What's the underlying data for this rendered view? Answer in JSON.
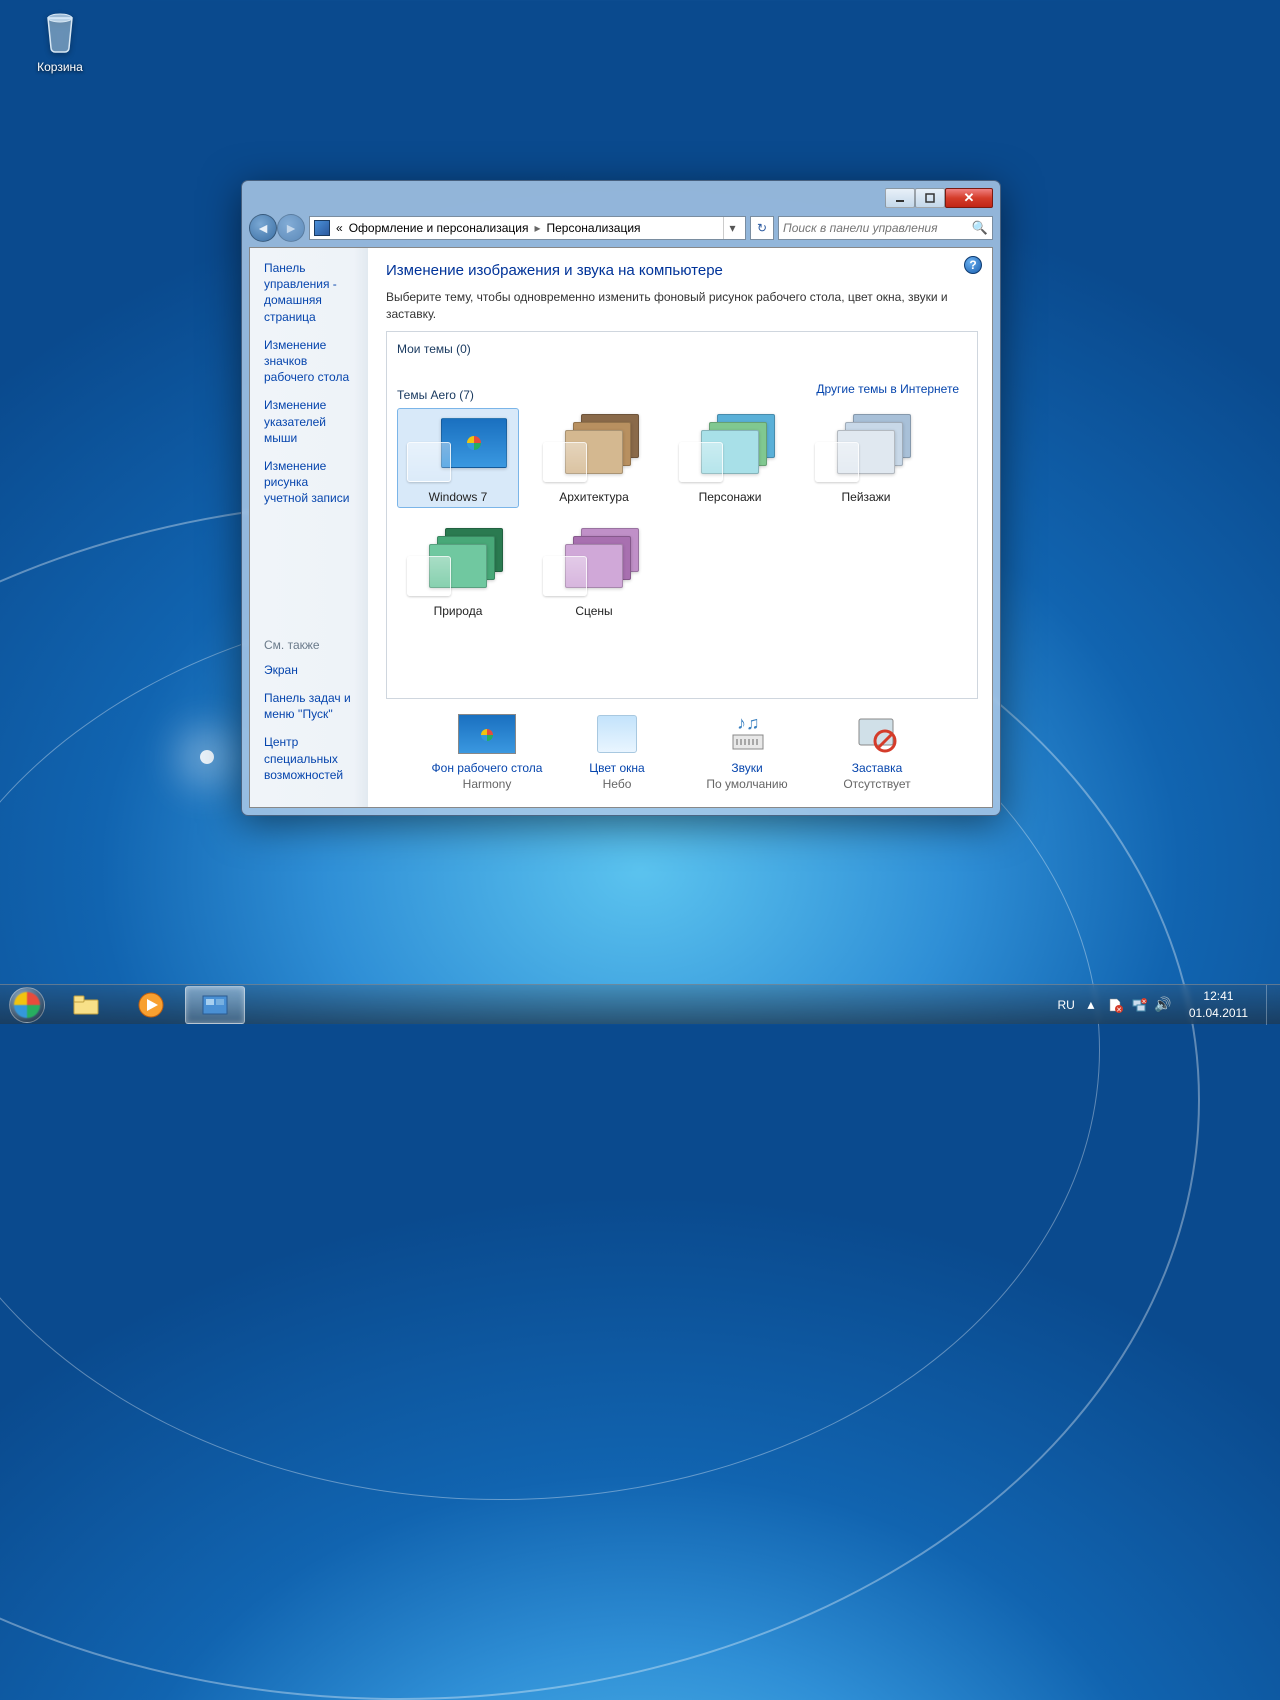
{
  "desktop": {
    "recycle_bin": "Корзина"
  },
  "window": {
    "breadcrumb": {
      "prefix": "«",
      "parent": "Оформление и персонализация",
      "current": "Персонализация"
    },
    "search_placeholder": "Поиск в панели управления",
    "sidebar": {
      "home": "Панель управления - домашняя страница",
      "links": [
        "Изменение значков рабочего стола",
        "Изменение указателей мыши",
        "Изменение рисунка учетной записи"
      ],
      "see_also_label": "См. также",
      "see_also": [
        "Экран",
        "Панель задач и меню ''Пуск''",
        "Центр специальных возможностей"
      ]
    },
    "main": {
      "title": "Изменение изображения и звука на компьютере",
      "description": "Выберите тему, чтобы одновременно изменить фоновый рисунок рабочего стола, цвет окна, звуки и заставку.",
      "my_themes": "Мои темы (0)",
      "aero_themes": "Темы Aero (7)",
      "more_online": "Другие темы в Интернете",
      "themes": [
        "Windows 7",
        "Архитектура",
        "Персонажи",
        "Пейзажи",
        "Природа",
        "Сцены"
      ],
      "settings": [
        {
          "title": "Фон рабочего стола",
          "sub": "Harmony"
        },
        {
          "title": "Цвет окна",
          "sub": "Небо"
        },
        {
          "title": "Звуки",
          "sub": "По умолчанию"
        },
        {
          "title": "Заставка",
          "sub": "Отсутствует"
        }
      ]
    }
  },
  "taskbar": {
    "lang": "RU",
    "time": "12:41",
    "date": "01.04.2011"
  },
  "theme_colors": {
    "win7": [
      "#3a8fd8"
    ],
    "arch": [
      "#8a6a4a",
      "#b89060",
      "#d4b890"
    ],
    "chars": [
      "#5ab0d8",
      "#80c890",
      "#a8e0e8"
    ],
    "land": [
      "#a8c0d8",
      "#c8d8e8",
      "#e0e8f0"
    ],
    "nature": [
      "#2a7a50",
      "#48a878",
      "#70c8a0"
    ],
    "scenes": [
      "#c090c8",
      "#a870b0",
      "#d0a8d8"
    ]
  }
}
